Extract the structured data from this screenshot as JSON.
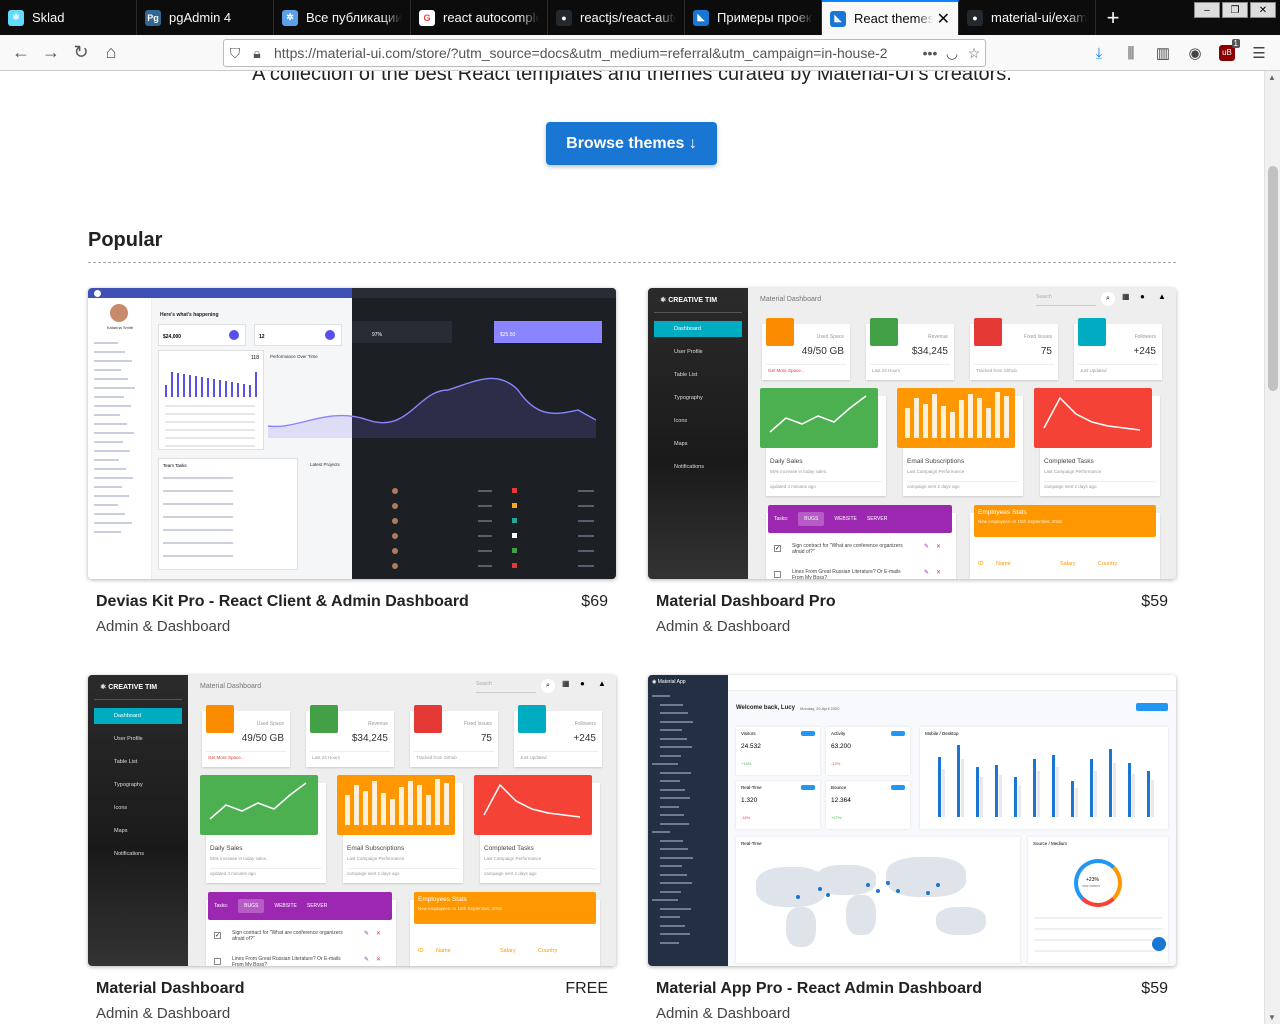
{
  "browser": {
    "tabs": [
      {
        "title": "Sklad",
        "icon": "react-icon",
        "color": "#61dafb",
        "active": false
      },
      {
        "title": "pgAdmin 4",
        "icon": "pgadmin-icon",
        "color": "#336791",
        "active": false
      },
      {
        "title": "Все публикации",
        "icon": "settings-icon",
        "color": "#5aa0e8",
        "active": false
      },
      {
        "title": "react autocomplet",
        "icon": "google-icon",
        "color": "#ea4335",
        "active": false
      },
      {
        "title": "reactjs/react-auto",
        "icon": "github-icon",
        "color": "#24292e",
        "active": false
      },
      {
        "title": "Примеры проект",
        "icon": "material-ui-icon",
        "color": "#1976d2",
        "active": false
      },
      {
        "title": "React themes",
        "icon": "material-ui-icon",
        "color": "#1976d2",
        "active": true
      },
      {
        "title": "material-ui/examp",
        "icon": "github-icon",
        "color": "#24292e",
        "active": false
      }
    ],
    "url": "https://material-ui.com/store/?utm_source=docs&utm_medium=referral&utm_campaign=in-house-2",
    "badge_count": "1"
  },
  "page": {
    "subtitle": "A collection of the best React templates and themes curated by Material-UI's creators.",
    "browse_label": "Browse themes ↓",
    "section_title": "Popular"
  },
  "cards": [
    {
      "title": "Devias Kit Pro - React Client & Admin Dashboard",
      "price": "$69",
      "category": "Admin & Dashboard"
    },
    {
      "title": "Material Dashboard Pro",
      "price": "$59",
      "category": "Admin & Dashboard"
    },
    {
      "title": "Material Dashboard",
      "price": "FREE",
      "category": "Admin & Dashboard"
    },
    {
      "title": "Material App Pro - React Admin Dashboard",
      "price": "$59",
      "category": "Admin & Dashboard"
    }
  ],
  "preview_ct": {
    "brand": "CREATIVE TIM",
    "header": "Material Dashboard",
    "search": "Search",
    "menu": [
      "Dashboard",
      "User Profile",
      "Table List",
      "Typography",
      "Icons",
      "Maps",
      "Notifications"
    ],
    "stats": [
      {
        "label": "Used Space",
        "value": "49/50 GB",
        "color": "#fb8c00",
        "foot": "Get More Space..."
      },
      {
        "label": "Revenue",
        "value": "$34,245",
        "color": "#43a047",
        "foot": "Last 24 Hours"
      },
      {
        "label": "Fixed Issues",
        "value": "75",
        "color": "#e53935",
        "foot": "Tracked from Github"
      },
      {
        "label": "Followers",
        "value": "+245",
        "color": "#00acc1",
        "foot": "Just Updated"
      }
    ],
    "charts": [
      {
        "title": "Daily Sales",
        "sub": "55% increase in today sales.",
        "foot": "updated 4 minutes ago",
        "color": "#4caf50"
      },
      {
        "title": "Email Subscriptions",
        "sub": "Last Campaign Performance",
        "foot": "campaign sent 2 days ago",
        "color": "#ff9800"
      },
      {
        "title": "Completed Tasks",
        "sub": "Last Campaign Performance",
        "foot": "campaign sent 2 days ago",
        "color": "#f44336"
      }
    ],
    "tasks_tabs": [
      "Tasks:",
      "BUGS",
      "WEBSITE",
      "SERVER"
    ],
    "tasks": [
      "Sign contract for \"What are conference organizers afraid of?\"",
      "Lines From Great Russian Literature? Or E-mails From My Boss?"
    ],
    "employees_title": "Employees Stats",
    "employees_sub": "New employees on 15th September, 2016",
    "employees_cols": [
      "ID",
      "Name",
      "Salary",
      "Country"
    ]
  },
  "preview_devias": {
    "greeting": "Here's what's happening",
    "user": "Katarina Smith",
    "stats": [
      "$24,000",
      "12",
      "97%",
      "$25.50"
    ],
    "active_users": "118",
    "chart_title": "Performance Over Time",
    "team_tasks": "Team Tasks",
    "latest_projects": "Latest Projects"
  },
  "preview_ma": {
    "brand": "Material App",
    "welcome": "Welcome back, Lucy",
    "date": "Monday, 29 April 2020",
    "stats": [
      {
        "label": "Visitors",
        "value": "24.532",
        "delta": "+14%"
      },
      {
        "label": "Activity",
        "value": "63.200",
        "delta": "-12%"
      },
      {
        "label": "Real-Time",
        "value": "1.320",
        "delta": "-18%"
      },
      {
        "label": "Bounce",
        "value": "12.364",
        "delta": "+27%"
      }
    ],
    "chart_title": "Mobile / Desktop",
    "map_title": "Real-Time",
    "source_title": "Source / Medium",
    "donut_value": "+23%",
    "donut_sub": "new visitors"
  }
}
